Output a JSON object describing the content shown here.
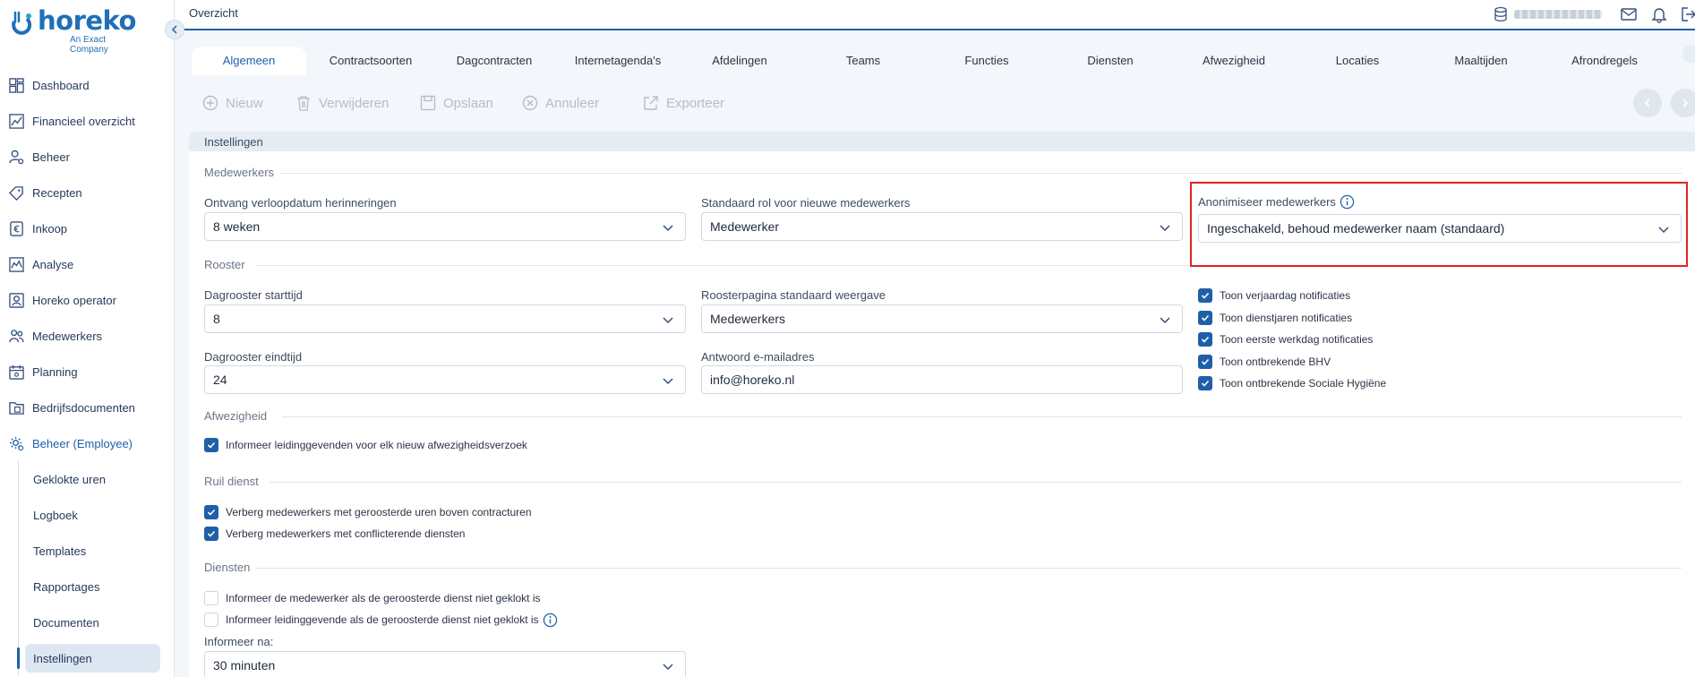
{
  "brand": {
    "name": "horeko",
    "subtitle": "An Exact Company",
    "color": "#1f6fb8"
  },
  "sidebar": {
    "items": [
      {
        "label": "Dashboard",
        "icon": "dashboard-icon"
      },
      {
        "label": "Financieel overzicht",
        "icon": "chart-icon"
      },
      {
        "label": "Beheer",
        "icon": "user-settings-icon"
      },
      {
        "label": "Recepten",
        "icon": "tag-icon"
      },
      {
        "label": "Inkoop",
        "icon": "euro-icon"
      },
      {
        "label": "Analyse",
        "icon": "analysis-icon"
      },
      {
        "label": "Horeko operator",
        "icon": "operator-icon"
      },
      {
        "label": "Medewerkers",
        "icon": "users-icon"
      },
      {
        "label": "Planning",
        "icon": "calendar-icon"
      },
      {
        "label": "Bedrijfsdocumenten",
        "icon": "folder-icon"
      },
      {
        "label": "Beheer (Employee)",
        "icon": "gear-user-icon"
      }
    ],
    "subitems": [
      "Geklokte uren",
      "Logboek",
      "Templates",
      "Rapportages",
      "Documenten",
      "Instellingen"
    ],
    "selected_subitem": "Instellingen"
  },
  "topbar": {
    "breadcrumb": "Overzicht"
  },
  "tabs": [
    "Algemeen",
    "Contractsoorten",
    "Dagcontracten",
    "Internetagenda's",
    "Afdelingen",
    "Teams",
    "Functies",
    "Diensten",
    "Afwezigheid",
    "Locaties",
    "Maaltijden",
    "Afrondregels"
  ],
  "active_tab": "Algemeen",
  "toolbar": {
    "new": "Nieuw",
    "delete": "Verwijderen",
    "save": "Opslaan",
    "cancel": "Annuleer",
    "export": "Exporteer"
  },
  "panel": {
    "title": "Instellingen",
    "sections": {
      "medewerkers": "Medewerkers",
      "rooster": "Rooster",
      "afwezigheid": "Afwezigheid",
      "ruil_dienst": "Ruil dienst",
      "diensten": "Diensten"
    },
    "fields": {
      "verloopdatum": {
        "label": "Ontvang verloopdatum herinneringen",
        "value": "8 weken"
      },
      "standaard_rol": {
        "label": "Standaard rol voor nieuwe medewerkers",
        "value": "Medewerker"
      },
      "anonimiseer": {
        "label": "Anonimiseer medewerkers",
        "value": "Ingeschakeld, behoud medewerker naam (standaard)"
      },
      "starttijd": {
        "label": "Dagrooster starttijd",
        "value": "8"
      },
      "weergave": {
        "label": "Roosterpagina standaard weergave",
        "value": "Medewerkers"
      },
      "eindtijd": {
        "label": "Dagrooster eindtijd",
        "value": "24"
      },
      "email": {
        "label": "Antwoord e-mailadres",
        "value": "info@horeko.nl"
      },
      "informeer_na": {
        "label": "Informeer na:",
        "value": "30 minuten"
      }
    },
    "rooster_checks": [
      {
        "label": "Toon verjaardag notificaties",
        "checked": true
      },
      {
        "label": "Toon dienstjaren notificaties",
        "checked": true
      },
      {
        "label": "Toon eerste werkdag notificaties",
        "checked": true
      },
      {
        "label": "Toon ontbrekende BHV",
        "checked": true
      },
      {
        "label": "Toon ontbrekende Sociale Hygiëne",
        "checked": true
      }
    ],
    "afwezigheid_check": {
      "label": "Informeer leidinggevenden voor elk nieuw afwezigheidsverzoek",
      "checked": true
    },
    "ruil_checks": [
      {
        "label": "Verberg medewerkers met geroosterde uren boven contracturen",
        "checked": true
      },
      {
        "label": "Verberg medewerkers met conflicterende diensten",
        "checked": true
      }
    ],
    "diensten_checks": [
      {
        "label": "Informeer de medewerker als de geroosterde dienst niet geklokt is",
        "checked": false
      },
      {
        "label": "Informeer leidinggevende als de geroosterde dienst niet geklokt is",
        "checked": false
      }
    ]
  },
  "colors": {
    "accent": "#1f5fa8",
    "highlight": "#e02424"
  }
}
